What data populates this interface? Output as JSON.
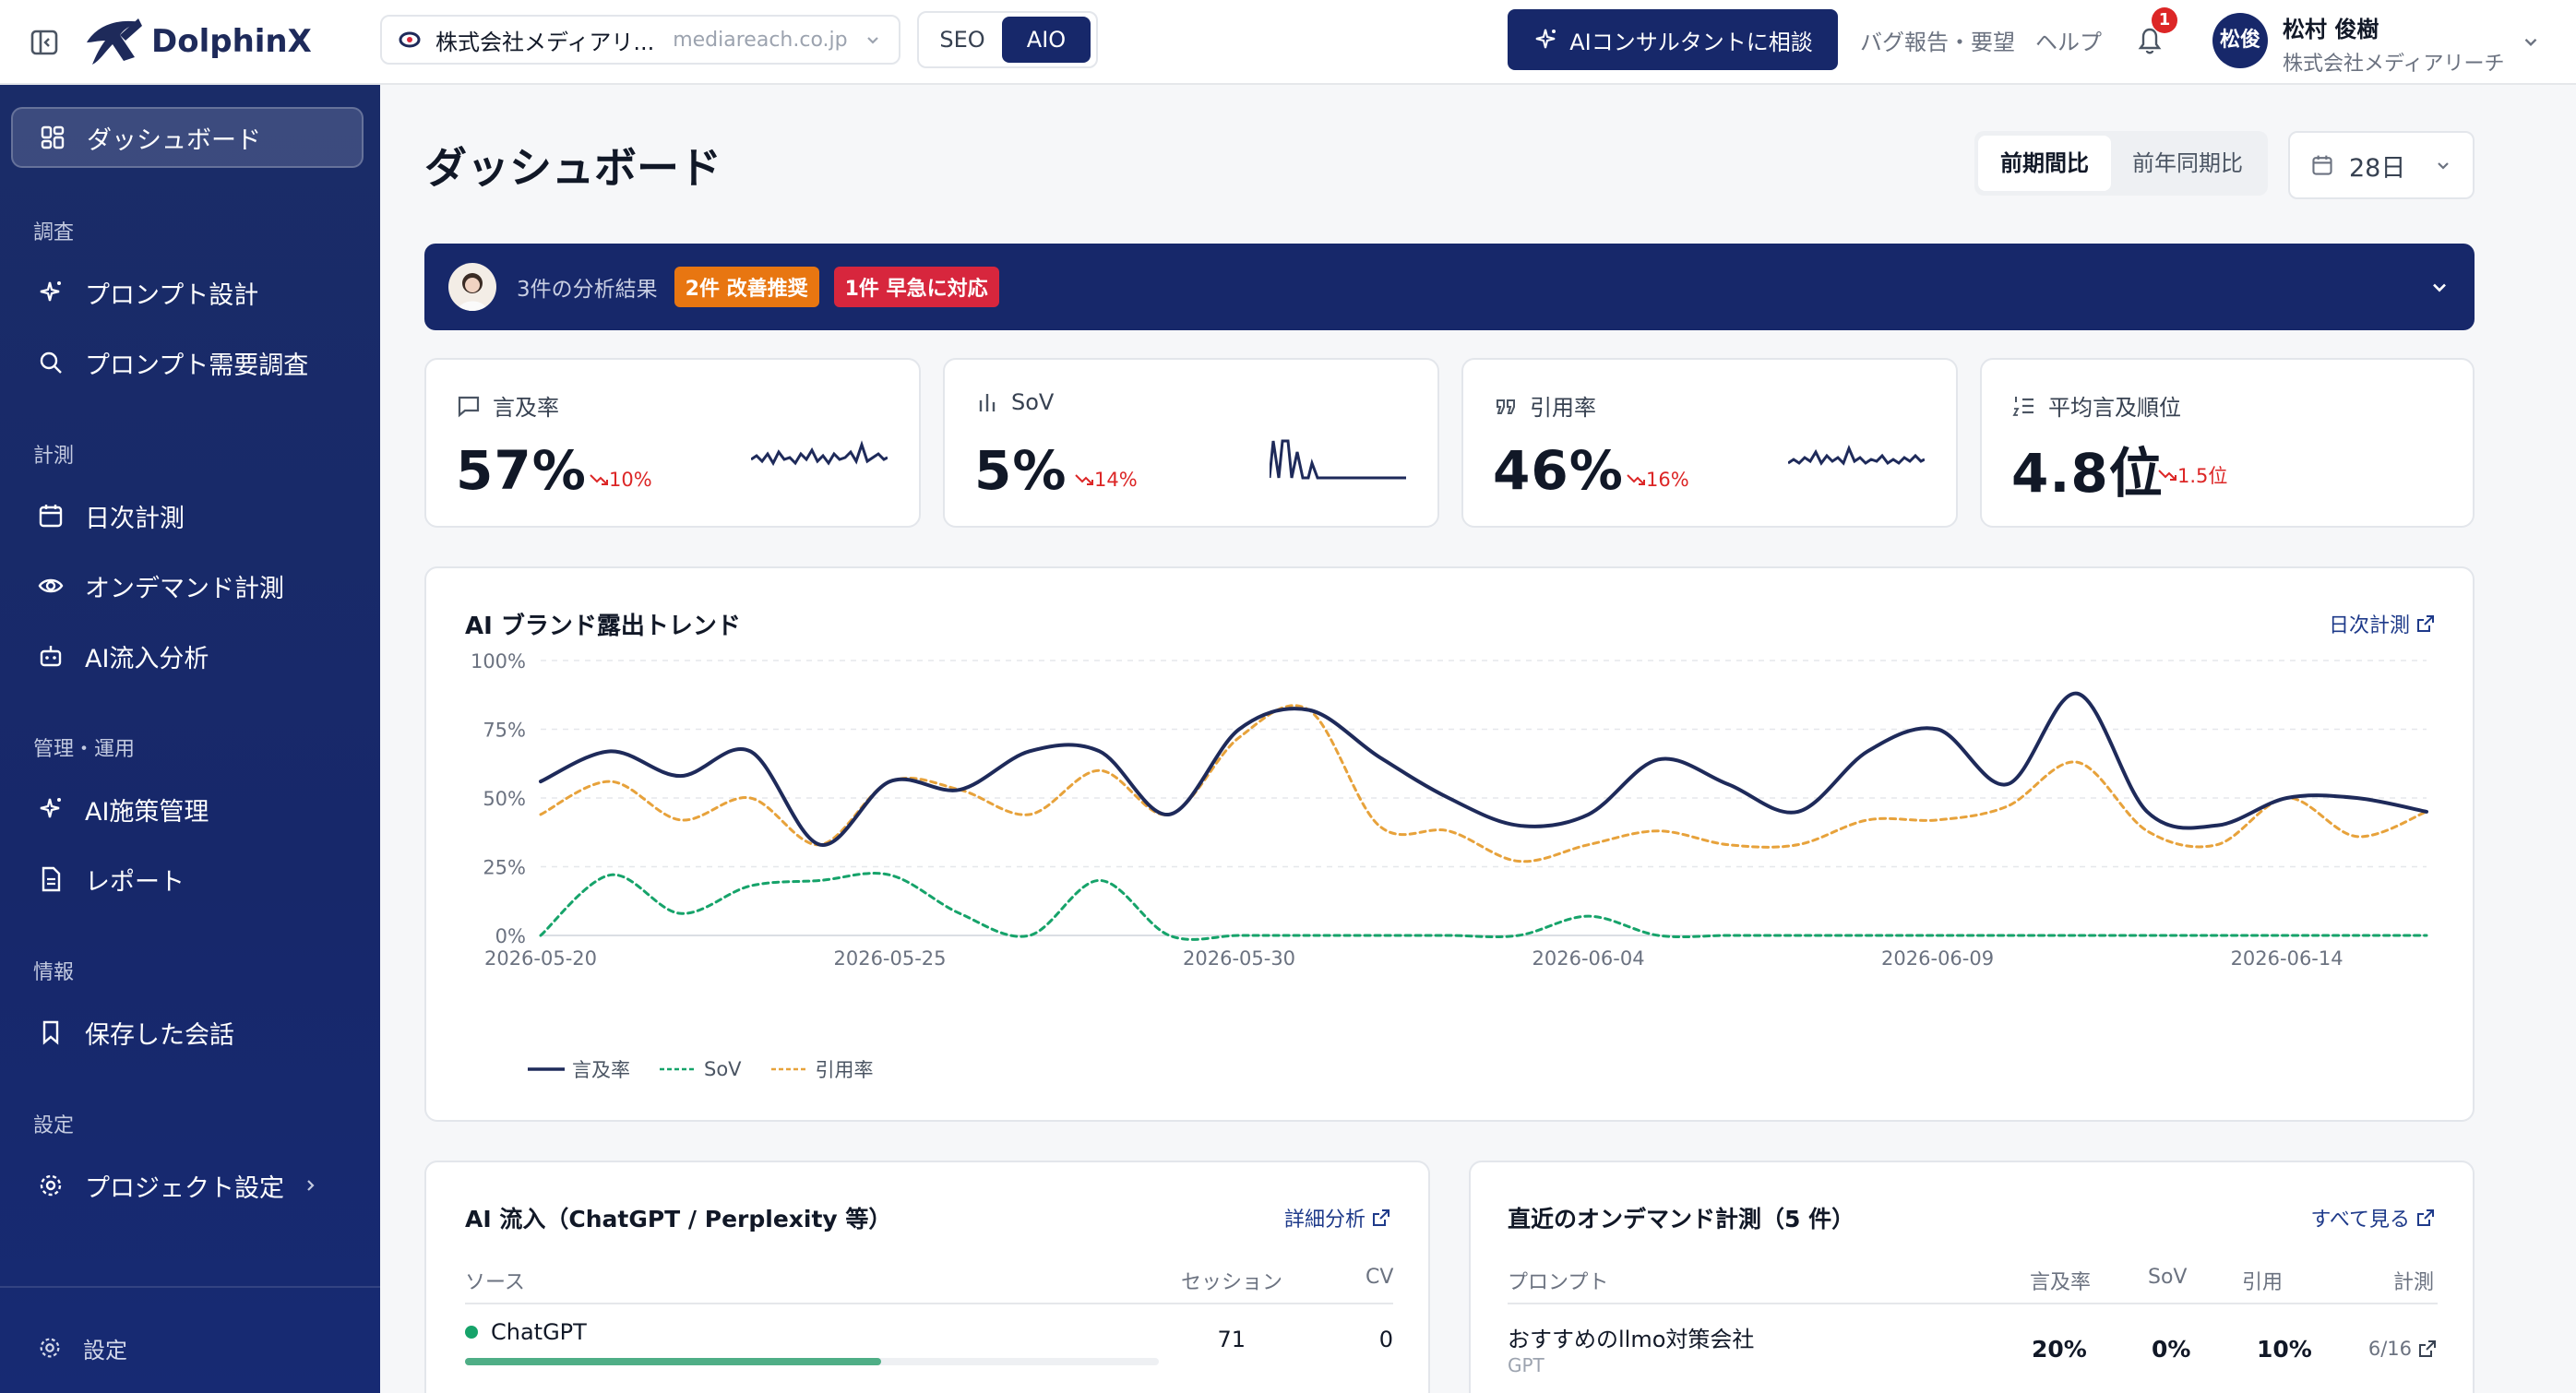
{
  "header": {
    "logo": "DolphinX",
    "project_name": "株式会社メディアリ...",
    "project_domain": "mediareach.co.jp",
    "mode_tabs": [
      "SEO",
      "AIO"
    ],
    "consult_button": "AIコンサルタントに相談",
    "bug_report": "バグ報告・要望",
    "help": "ヘルプ",
    "notification_count": "1",
    "user_avatar": "松俊",
    "user_name": "松村 俊樹",
    "user_company": "株式会社メディアリーチ"
  },
  "sidebar": {
    "dashboard": "ダッシュボード",
    "sections": [
      "調査",
      "計測",
      "管理・運用",
      "情報",
      "設定"
    ],
    "items": {
      "prompt_design": "プロンプト設計",
      "prompt_demand": "プロンプト需要調査",
      "daily": "日次計測",
      "ondemand": "オンデマンド計測",
      "ai_inflow": "AI流入分析",
      "ai_measures": "AI施策管理",
      "report": "レポート",
      "saved": "保存した会話",
      "project_settings": "プロジェクト設定",
      "settings": "設定"
    }
  },
  "page": {
    "title": "ダッシュボード",
    "compare_tabs": [
      "前期間比",
      "前年同期比"
    ],
    "range": "28日"
  },
  "banner": {
    "text": "3件の分析結果",
    "badge_improve": "2件 改善推奨",
    "badge_urgent": "1件 早急に対応"
  },
  "kpis": [
    {
      "label": "言及率",
      "value": "57%",
      "delta": "10%"
    },
    {
      "label": "SoV",
      "value": "5%",
      "delta": "14%"
    },
    {
      "label": "引用率",
      "value": "46%",
      "delta": "16%"
    },
    {
      "label": "平均言及順位",
      "value": "4.8位",
      "delta": "1.5位"
    }
  ],
  "trend": {
    "title": "AI ブランド露出トレンド",
    "link": "日次計測"
  },
  "chart_data": {
    "type": "line",
    "x": [
      "2026-05-20",
      "2026-05-21",
      "2026-05-22",
      "2026-05-23",
      "2026-05-24",
      "2026-05-25",
      "2026-05-26",
      "2026-05-27",
      "2026-05-28",
      "2026-05-29",
      "2026-05-30",
      "2026-05-31",
      "2026-06-01",
      "2026-06-02",
      "2026-06-03",
      "2026-06-04",
      "2026-06-05",
      "2026-06-06",
      "2026-06-07",
      "2026-06-08",
      "2026-06-09",
      "2026-06-10",
      "2026-06-11",
      "2026-06-12",
      "2026-06-13",
      "2026-06-14",
      "2026-06-15",
      "2026-06-16"
    ],
    "x_ticks": [
      "2026-05-20",
      "2026-05-25",
      "2026-05-30",
      "2026-06-04",
      "2026-06-09",
      "2026-06-14"
    ],
    "y_ticks": [
      "0%",
      "25%",
      "50%",
      "75%",
      "100%"
    ],
    "ylim": [
      0,
      100
    ],
    "series": [
      {
        "name": "言及率",
        "color": "#1e2a5a",
        "dash": false,
        "values": [
          56,
          67,
          58,
          67,
          33,
          56,
          53,
          67,
          67,
          44,
          75,
          82,
          65,
          50,
          40,
          44,
          64,
          55,
          45,
          67,
          75,
          55,
          88,
          45,
          40,
          50,
          50,
          45
        ]
      },
      {
        "name": "SoV",
        "color": "#16a36a",
        "dash": true,
        "values": [
          0,
          22,
          8,
          18,
          20,
          22,
          8,
          0,
          20,
          0,
          0,
          0,
          0,
          0,
          0,
          7,
          0,
          0,
          0,
          0,
          0,
          0,
          0,
          0,
          0,
          0,
          0,
          0
        ]
      },
      {
        "name": "引用率",
        "color": "#e7a23b",
        "dash": true,
        "values": [
          44,
          56,
          42,
          50,
          33,
          56,
          53,
          44,
          60,
          44,
          72,
          82,
          40,
          38,
          27,
          33,
          38,
          33,
          33,
          42,
          42,
          47,
          63,
          38,
          33,
          50,
          36,
          45
        ]
      }
    ],
    "grid": true,
    "legend": "bottom-left"
  },
  "ai_inflow": {
    "title": "AI 流入（ChatGPT / Perplexity 等）",
    "link": "詳細分析",
    "columns": [
      "ソース",
      "セッション",
      "CV"
    ],
    "rows": [
      {
        "source": "ChatGPT",
        "sessions": "71",
        "cv": "0",
        "share": 0.6
      }
    ]
  },
  "ondemand": {
    "title": "直近のオンデマンド計測（5 件）",
    "link": "すべて見る",
    "columns": [
      "プロンプト",
      "言及率",
      "SoV",
      "引用",
      "計測"
    ],
    "rows": [
      {
        "prompt": "おすすめのllmo対策会社",
        "model": "GPT",
        "mention": "20%",
        "sov": "0%",
        "cite": "10%",
        "date": "6/16"
      }
    ]
  },
  "colors": {
    "primary": "#17286a",
    "accent_orange": "#e87611",
    "accent_red": "#d7263d",
    "mention": "#1e2a5a",
    "sov": "#16a36a",
    "cite": "#e7a23b"
  }
}
